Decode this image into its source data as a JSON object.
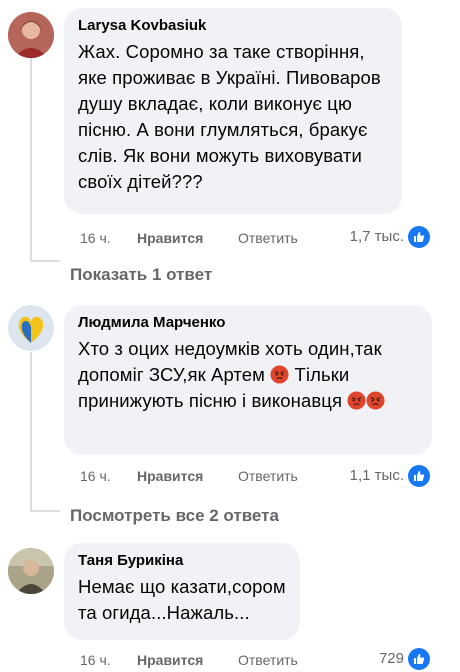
{
  "comments": [
    {
      "author": "Larysa Kovbasiuk",
      "text": "Жах. Соромно за таке створіння, яке проживає в Україні. Пивоваров душу вкладає, коли виконує цю пісню. А вони глумляться, бракує слів. Як вони можуть виховувати своїх дітей???",
      "time": "16 ч.",
      "like_label": "Нравится",
      "reply_label": "Ответить",
      "reactions": "1,7 тыс.",
      "reaction_icon": "like-icon",
      "replies_link": "Показать 1 ответ"
    },
    {
      "author": "Людмила Марченко",
      "text_parts": [
        "Хто з оцих недоумків хоть один,так допоміг ЗСУ,як Артем",
        "Тільки принижують пісню і виконавця"
      ],
      "emoji": "angry-face-icon",
      "time": "16 ч.",
      "like_label": "Нравится",
      "reply_label": "Ответить",
      "reactions": "1,1 тыс.",
      "reaction_icon": "like-icon",
      "replies_link": "Посмотреть все 2 ответа"
    },
    {
      "author": "Таня Бурикіна",
      "text": "Немає що казати,сором та огида...Нажаль...",
      "time": "16 ч.",
      "like_label": "Нравится",
      "reply_label": "Ответить",
      "reactions": "729",
      "reaction_icon": "like-icon"
    }
  ],
  "colors": {
    "bubble": "#f0f2f5",
    "meta_text": "#65676b",
    "like_blue": "#1877f2",
    "thread_line": "#dadde1"
  }
}
